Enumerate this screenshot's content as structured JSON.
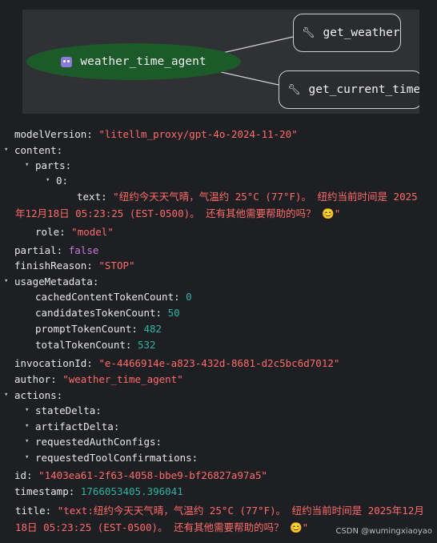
{
  "graph": {
    "agent_label": "weather_time_agent",
    "tools": [
      "get_weather",
      "get_current_time"
    ]
  },
  "event": {
    "modelVersion_key": "modelVersion:",
    "modelVersion_val": "\"litellm_proxy/gpt-4o-2024-11-20\"",
    "content_key": "content:",
    "parts_key": "parts:",
    "index0": "0:",
    "text_key": "text:",
    "text_val": "\"纽约今天天气晴，气温约 25°C (77°F)。 纽约当前时间是 2025年12月18日 05:23:25 (EST-0500)。 还有其他需要帮助的吗？ 😊\"",
    "role_key": "role:",
    "role_val": "\"model\"",
    "partial_key": "partial:",
    "partial_val": "false",
    "finishReason_key": "finishReason:",
    "finishReason_val": "\"STOP\"",
    "usageMetadata_key": "usageMetadata:",
    "usage": [
      {
        "key": "cachedContentTokenCount:",
        "val": "0"
      },
      {
        "key": "candidatesTokenCount:",
        "val": "50"
      },
      {
        "key": "promptTokenCount:",
        "val": "482"
      },
      {
        "key": "totalTokenCount:",
        "val": "532"
      }
    ],
    "invocationId_key": "invocationId:",
    "invocationId_val": "\"e-4466914e-a823-432d-8681-d2c5bc6d7012\"",
    "author_key": "author:",
    "author_val": "\"weather_time_agent\"",
    "actions_key": "actions:",
    "actions": [
      "stateDelta:",
      "artifactDelta:",
      "requestedAuthConfigs:",
      "requestedToolConfirmations:"
    ],
    "id_key": "id:",
    "id_val": "\"1403ea61-2f63-4058-bbe9-bf26827a97a5\"",
    "timestamp_key": "timestamp:",
    "timestamp_val": "1766053405.396041",
    "title_key": "title:",
    "title_val": "\"text:纽约今天天气晴，气温约 25°C (77°F)。 纽约当前时间是 2025年12月18日 05:23:25 (EST-0500)。 还有其他需要帮助的吗？ 😊\""
  },
  "footer": "CSDN @wumingxiaoyao"
}
